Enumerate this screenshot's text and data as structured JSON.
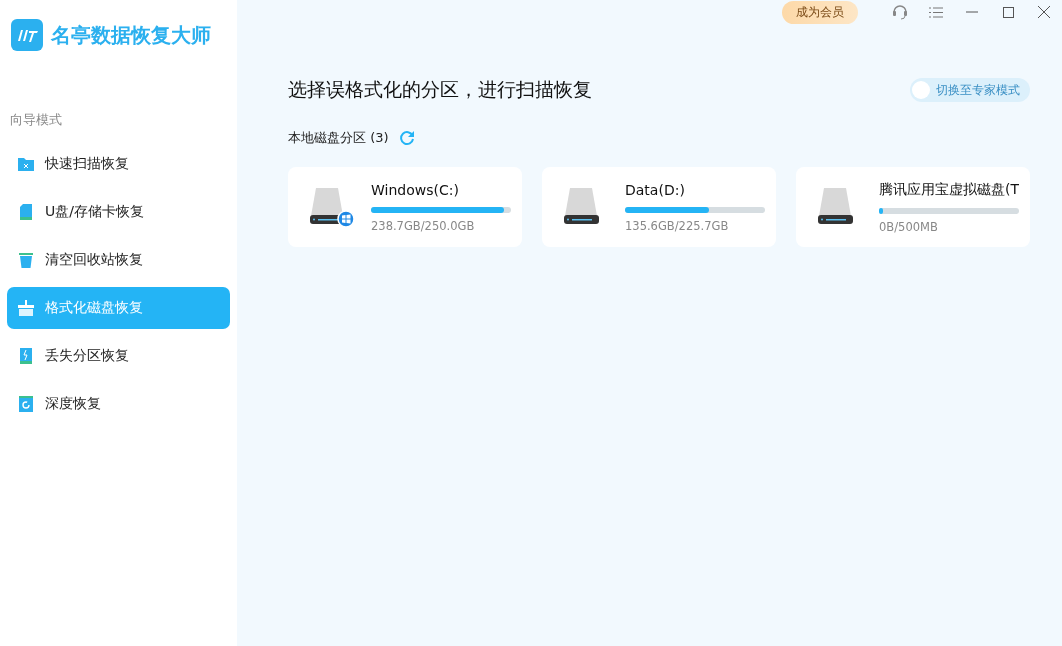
{
  "app": {
    "name": "名亭数据恢复大师"
  },
  "sidebar": {
    "section": "向导模式",
    "items": [
      {
        "label": "快速扫描恢复",
        "kind": "folder",
        "selected": false
      },
      {
        "label": "U盘/存储卡恢复",
        "kind": "card",
        "selected": false
      },
      {
        "label": "清空回收站恢复",
        "kind": "bin",
        "selected": false
      },
      {
        "label": "格式化磁盘恢复",
        "kind": "format",
        "selected": true
      },
      {
        "label": "丢失分区恢复",
        "kind": "partition",
        "selected": false
      },
      {
        "label": "深度恢复",
        "kind": "deep",
        "selected": false
      }
    ]
  },
  "topbar": {
    "vip_button": "成为会员"
  },
  "main": {
    "title": "选择误格式化的分区，进行扫描恢复",
    "expert_toggle": {
      "label": "切换至专家模式",
      "on": false
    },
    "section": "本地磁盘分区 (3)",
    "drives": [
      {
        "name": "Windows(C:)",
        "kind": "system",
        "level": 0.95,
        "usage": "238.7GB/250.0GB"
      },
      {
        "name": "Data(D:)",
        "kind": "plain",
        "level": 0.6,
        "usage": "135.6GB/225.7GB"
      },
      {
        "name": "腾讯应用宝虚拟磁盘(T",
        "kind": "plain",
        "level": 0.03,
        "usage": "0B/500MB"
      }
    ]
  }
}
